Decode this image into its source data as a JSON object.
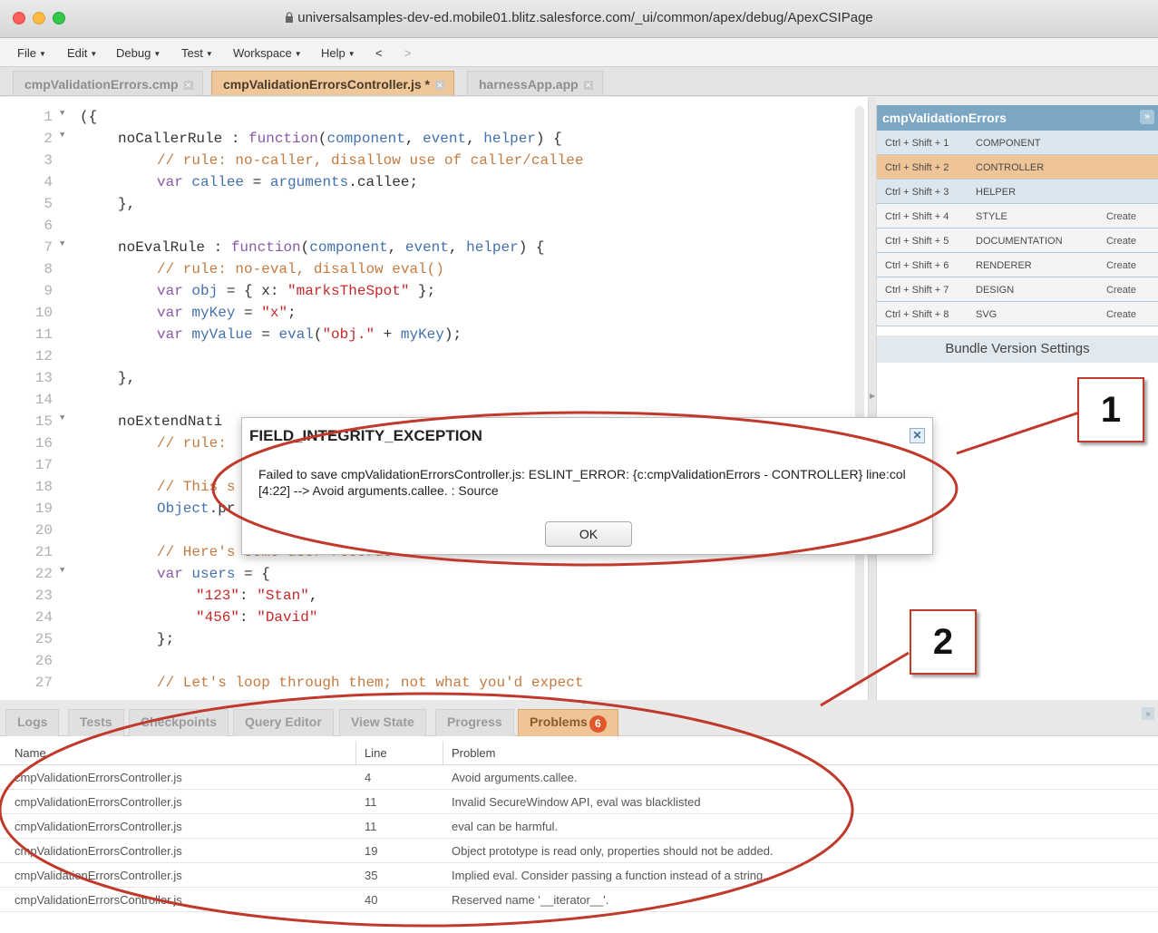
{
  "window": {
    "url": "universalsamples-dev-ed.mobile01.blitz.salesforce.com/_ui/common/apex/debug/ApexCSIPage"
  },
  "menu": [
    "File",
    "Edit",
    "Debug",
    "Test",
    "Workspace",
    "Help"
  ],
  "nav": {
    "back": "<",
    "forward": ">"
  },
  "tabs": [
    {
      "label": "cmpValidationErrors.cmp"
    },
    {
      "label": "cmpValidationErrorsController.js *"
    },
    {
      "label": "harnessApp.app"
    }
  ],
  "editor": {
    "lines": [
      {
        "n": "1",
        "fold": true
      },
      {
        "n": "2",
        "fold": true
      },
      {
        "n": "3"
      },
      {
        "n": "4"
      },
      {
        "n": "5"
      },
      {
        "n": "6"
      },
      {
        "n": "7",
        "fold": true
      },
      {
        "n": "8"
      },
      {
        "n": "9"
      },
      {
        "n": "10"
      },
      {
        "n": "11"
      },
      {
        "n": "12"
      },
      {
        "n": "13"
      },
      {
        "n": "14"
      },
      {
        "n": "15",
        "fold": true
      },
      {
        "n": "16"
      },
      {
        "n": "17"
      },
      {
        "n": "18"
      },
      {
        "n": "19"
      },
      {
        "n": "20"
      },
      {
        "n": "21"
      },
      {
        "n": "22",
        "fold": true
      },
      {
        "n": "23"
      },
      {
        "n": "24"
      },
      {
        "n": "25"
      },
      {
        "n": "26"
      },
      {
        "n": "27"
      }
    ],
    "code": {
      "l1": "({",
      "l2a": "noCallerRule",
      "l2b": " : ",
      "l2c": "function",
      "l2d": "(",
      "l2e": "component",
      "l2f": ", ",
      "l2g": "event",
      "l2h": ", ",
      "l2i": "helper",
      "l2j": ") {",
      "l3": "// rule: no-caller, disallow use of caller/callee",
      "l4a": "var",
      "l4b": " callee",
      "l4c": " = ",
      "l4d": "arguments",
      "l4e": ".callee;",
      "l5": "},",
      "l7a": "noEvalRule",
      "l7b": " : ",
      "l7c": "function",
      "l7d": "(",
      "l7e": "component",
      "l7f": ", ",
      "l7g": "event",
      "l7h": ", ",
      "l7i": "helper",
      "l7j": ") {",
      "l8": "// rule: no-eval, disallow eval()",
      "l9a": "var",
      "l9b": " obj",
      "l9c": " = { x: ",
      "l9d": "\"marksTheSpot\"",
      "l9e": " };",
      "l10a": "var",
      "l10b": " myKey",
      "l10c": " = ",
      "l10d": "\"x\"",
      "l10e": ";",
      "l11a": "var",
      "l11b": " myValue",
      "l11c": " = ",
      "l11d": "eval",
      "l11e": "(",
      "l11f": "\"obj.\"",
      "l11g": " + ",
      "l11h": "myKey",
      "l11i": ");",
      "l13": "},",
      "l15": "noExtendNati",
      "l16": "// rule:",
      "l18": "// This s",
      "l19a": "Object",
      "l19b": ".pr",
      "l21": "// Here's some user records",
      "l22a": "var",
      "l22b": " users",
      "l22c": " = {",
      "l23a": "\"123\"",
      "l23b": ": ",
      "l23c": "\"Stan\"",
      "l23d": ",",
      "l24a": "\"456\"",
      "l24b": ": ",
      "l24c": "\"David\"",
      "l25": "};",
      "l27": "// Let's loop through them; not what you'd expect"
    }
  },
  "bundle": {
    "title": "cmpValidationErrors",
    "items": [
      {
        "key": "Ctrl + Shift + 1",
        "name": "COMPONENT",
        "action": ""
      },
      {
        "key": "Ctrl + Shift + 2",
        "name": "CONTROLLER",
        "action": ""
      },
      {
        "key": "Ctrl + Shift + 3",
        "name": "HELPER",
        "action": ""
      },
      {
        "key": "Ctrl + Shift + 4",
        "name": "STYLE",
        "action": "Create"
      },
      {
        "key": "Ctrl + Shift + 5",
        "name": "DOCUMENTATION",
        "action": "Create"
      },
      {
        "key": "Ctrl + Shift + 6",
        "name": "RENDERER",
        "action": "Create"
      },
      {
        "key": "Ctrl + Shift + 7",
        "name": "DESIGN",
        "action": "Create"
      },
      {
        "key": "Ctrl + Shift + 8",
        "name": "SVG",
        "action": "Create"
      }
    ],
    "settings_label": "Bundle Version Settings"
  },
  "dialog": {
    "title": "FIELD_INTEGRITY_EXCEPTION",
    "message": "Failed to save cmpValidationErrorsController.js: ESLINT_ERROR: {c:cmpValidationErrors - CONTROLLER} line:col [4:22] --> Avoid arguments.callee. : Source",
    "ok_label": "OK",
    "close_glyph": "✕"
  },
  "bottom_tabs": [
    {
      "label": "Logs"
    },
    {
      "label": "Tests"
    },
    {
      "label": "Checkpoints"
    },
    {
      "label": "Query Editor"
    },
    {
      "label": "View State"
    },
    {
      "label": "Progress"
    },
    {
      "label": "Problems",
      "badge": "6"
    }
  ],
  "problems": {
    "headers": {
      "name": "Name",
      "line": "Line",
      "problem": "Problem"
    },
    "rows": [
      {
        "name": "cmpValidationErrorsController.js",
        "line": "4",
        "problem": "Avoid arguments.callee."
      },
      {
        "name": "cmpValidationErrorsController.js",
        "line": "11",
        "problem": "Invalid SecureWindow API, eval was blacklisted"
      },
      {
        "name": "cmpValidationErrorsController.js",
        "line": "11",
        "problem": "eval can be harmful."
      },
      {
        "name": "cmpValidationErrorsController.js",
        "line": "19",
        "problem": "Object prototype is read only, properties should not be added."
      },
      {
        "name": "cmpValidationErrorsController.js",
        "line": "35",
        "problem": "Implied eval. Consider passing a function instead of a string."
      },
      {
        "name": "cmpValidationErrorsController.js",
        "line": "40",
        "problem": "Reserved name '__iterator__'."
      }
    ]
  },
  "callouts": [
    "1",
    "2"
  ],
  "colors": {
    "accent": "#efc598",
    "callout": "#c0392b",
    "panel_header": "#7ba7c4"
  }
}
